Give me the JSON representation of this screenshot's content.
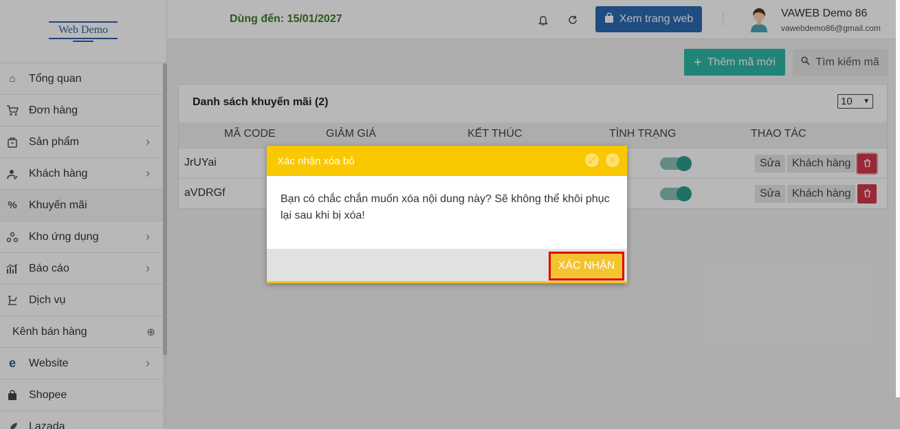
{
  "logo": {
    "text": "Web Demo"
  },
  "header": {
    "expiry": "Dùng đến: 15/01/2027",
    "view_site": "Xem trang web",
    "user_name": "VAWEB Demo 86",
    "user_email": "vawebdemo86@gmail.com"
  },
  "sidebar": {
    "items": [
      {
        "label": "Tổng quan",
        "icon": "home-icon"
      },
      {
        "label": "Đơn hàng",
        "icon": "cart-icon"
      },
      {
        "label": "Sản phẩm",
        "icon": "box-icon"
      },
      {
        "label": "Khách hàng",
        "icon": "user-icon"
      },
      {
        "label": "Khuyến mãi",
        "icon": "percent-icon"
      },
      {
        "label": "Kho ứng dụng",
        "icon": "apps-icon"
      },
      {
        "label": "Báo cáo",
        "icon": "chart-icon"
      },
      {
        "label": "Dịch vụ",
        "icon": "service-icon"
      },
      {
        "label": "Kênh bán hàng",
        "icon": "plus-circle-icon"
      },
      {
        "label": "Website",
        "icon": "ie-icon"
      },
      {
        "label": "Shopee",
        "icon": "bag-icon"
      },
      {
        "label": "Lazada",
        "icon": "rocket-icon"
      }
    ]
  },
  "toolbar": {
    "add_label": "Thêm mã mới",
    "search_label": "Tìm kiếm mã"
  },
  "panel": {
    "title": "Danh sách khuyến mãi (2)",
    "page_size": "10",
    "columns": [
      "MÃ CODE",
      "GIẢM GIÁ",
      "KẾT THÚC",
      "TÌNH TRẠNG",
      "THAO TÁC"
    ],
    "rows": [
      {
        "code": "JrUYai",
        "edit": "Sửa",
        "customers": "Khách hàng"
      },
      {
        "code": "aVDRGf",
        "edit": "Sửa",
        "customers": "Khách hàng"
      }
    ]
  },
  "modal": {
    "title": "Xác nhận xóa bỏ",
    "message": "Bạn có chắc chắn muốn xóa nội dung này? Sẽ không thể khôi phục lại sau khi bị xóa!",
    "confirm": "XÁC NHẬN"
  }
}
